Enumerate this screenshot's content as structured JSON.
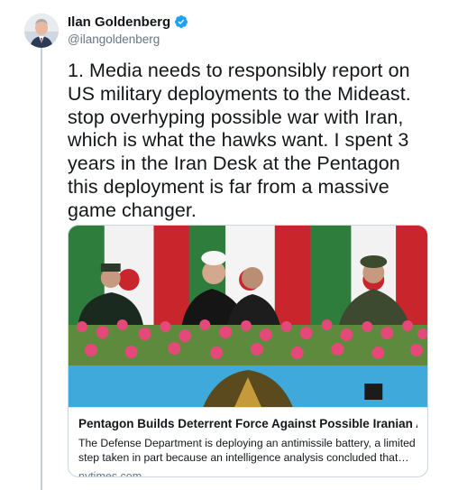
{
  "tweet": {
    "display_name": "Ilan Goldenberg",
    "handle": "@ilangoldenberg",
    "verified": true,
    "text": "1. Media needs to responsibly report on\nUS military deployments to the Mideast.\nstop overhyping possible war with Iran,\nwhich is what the hawks want. I spent 3\nyears in the Iran Desk at the Pentagon\nthis deployment is far from a massive\ngame changer."
  },
  "card": {
    "title": "Pentagon Builds Deterrent Force Against Possible Iranian Attack",
    "description": "The Defense Department is deploying an antimissile battery, a limited step taken in part because an intelligence analysis concluded that Iran is trying...",
    "domain": "nytimes.com"
  },
  "icons": {
    "verified": "verified-badge-icon",
    "caret": "chevron-down-icon"
  },
  "colors": {
    "verified_blue": "#1da1f2",
    "thread_line": "#c4cfd6",
    "secondary_text": "#657786",
    "border": "#ccd6dd"
  }
}
